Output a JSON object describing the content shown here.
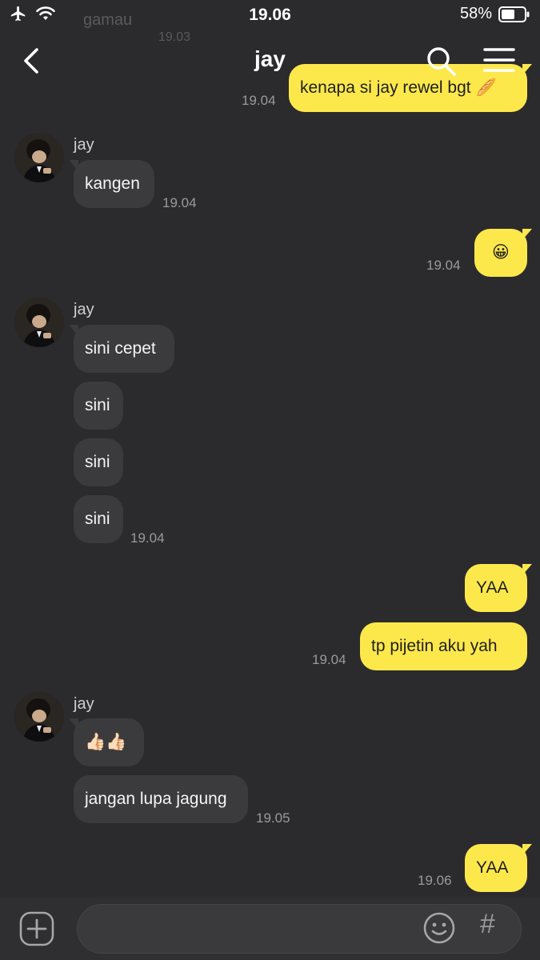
{
  "status_bar": {
    "time": "19.06",
    "battery_text": "58%"
  },
  "header": {
    "title": "jay"
  },
  "ghost": {
    "text": "gamau",
    "time": "19.03"
  },
  "messages": [
    {
      "dir": "out",
      "text": "kenapa si jay rewel bgt 🥖",
      "time": "19.04"
    },
    {
      "dir": "in",
      "sender": "jay",
      "text": "kangen",
      "time": "19.04"
    },
    {
      "dir": "out",
      "text": "😀",
      "time": "19.04"
    },
    {
      "dir": "in",
      "sender": "jay",
      "text": "sini cepet"
    },
    {
      "dir": "in",
      "text": "sini"
    },
    {
      "dir": "in",
      "text": "sini"
    },
    {
      "dir": "in",
      "text": "sini",
      "time": "19.04"
    },
    {
      "dir": "out",
      "text": "YAA"
    },
    {
      "dir": "out",
      "text": "tp pijetin aku yah",
      "time": "19.04"
    },
    {
      "dir": "in",
      "sender": "jay",
      "text": "👍🏻👍🏻"
    },
    {
      "dir": "in",
      "text": "jangan lupa jagung",
      "time": "19.05"
    },
    {
      "dir": "out",
      "text": "YAA",
      "time": "19.06"
    }
  ],
  "input": {
    "placeholder": ""
  },
  "icons": {
    "back": "chevron-left-icon",
    "search": "search-icon",
    "menu": "hamburger-menu-icon",
    "add": "plus-icon",
    "emoji": "emoji-icon",
    "hashtag": "hashtag-icon"
  },
  "colors": {
    "background": "#2b2b2e",
    "incoming_bubble": "#3b3b3d",
    "outgoing_bubble": "#fde84c"
  }
}
